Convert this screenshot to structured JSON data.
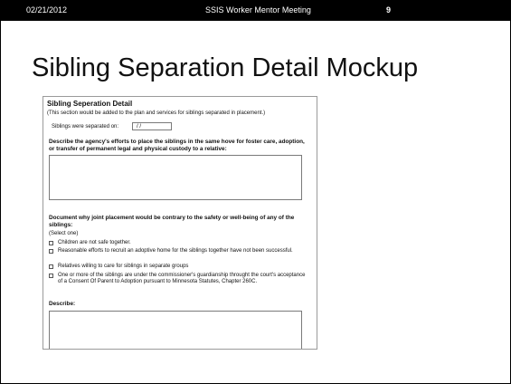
{
  "header": {
    "date": "02/21/2012",
    "meeting": "SSIS Worker Mentor Meeting",
    "page_number": "9"
  },
  "slide_title": "Sibling Separation Detail Mockup",
  "form": {
    "title": "Sibling Seperation Detail",
    "note": "(This section would be added to the plan and services for siblings separated in placement.)",
    "separated_label": "Siblings were separated on:",
    "separated_value": "/ /",
    "question1": "Describe the agency's efforts to place the siblings in the same hove for foster care, adoption, or transfer of permanent legal and physical custody to a relative:",
    "question2": "Document why joint placement would be contrary to the safety or well-being of any of the siblings:",
    "select_one": "(Select one)",
    "options": [
      "Children are not safe together.",
      "Reasonable efforts to recruit an adoptive home for the siblings together have not been successful.",
      "Relatives willing to care for siblings in separate groups",
      "One or more of the siblings are under the commissioner's guardianship throught the court's acceptance of a Consent Of Parent to Adoption pursuant to Minnesota Statutes, Chapter 260C."
    ],
    "describe_label": "Describe:"
  }
}
